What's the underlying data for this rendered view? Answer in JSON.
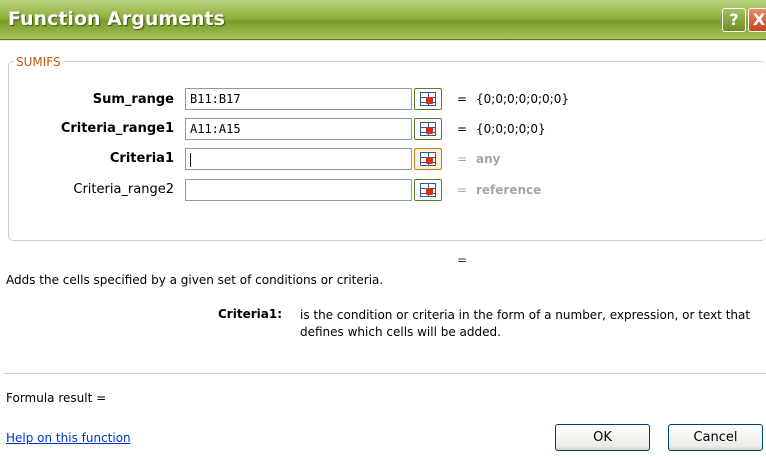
{
  "window": {
    "title": "Function Arguments",
    "help_label": "?",
    "close_label": "X"
  },
  "group": {
    "legend": "SUMIFS"
  },
  "arguments": [
    {
      "label": "Sum_range",
      "value": "B11:B17",
      "result": "{0;0;0;0;0;0;0}",
      "bold": true
    },
    {
      "label": "Criteria_range1",
      "value": "A11:A15",
      "result": "{0;0;0;0;0}",
      "bold": true
    },
    {
      "label": "Criteria1",
      "value": "",
      "result": "any",
      "bold": true
    },
    {
      "label": "Criteria_range2",
      "value": "",
      "result": "reference",
      "bold": false
    }
  ],
  "equals_sign": "=",
  "overall_result": "=",
  "description": "Adds the cells specified by a given set of conditions or criteria.",
  "argument_help": {
    "name": "Criteria1:",
    "text": "is the condition or criteria in the form of a number, expression, or text that defines which cells will be added."
  },
  "formula_result": "Formula result =",
  "help_link": "Help on this function",
  "buttons": {
    "ok": "OK",
    "cancel": "Cancel"
  }
}
